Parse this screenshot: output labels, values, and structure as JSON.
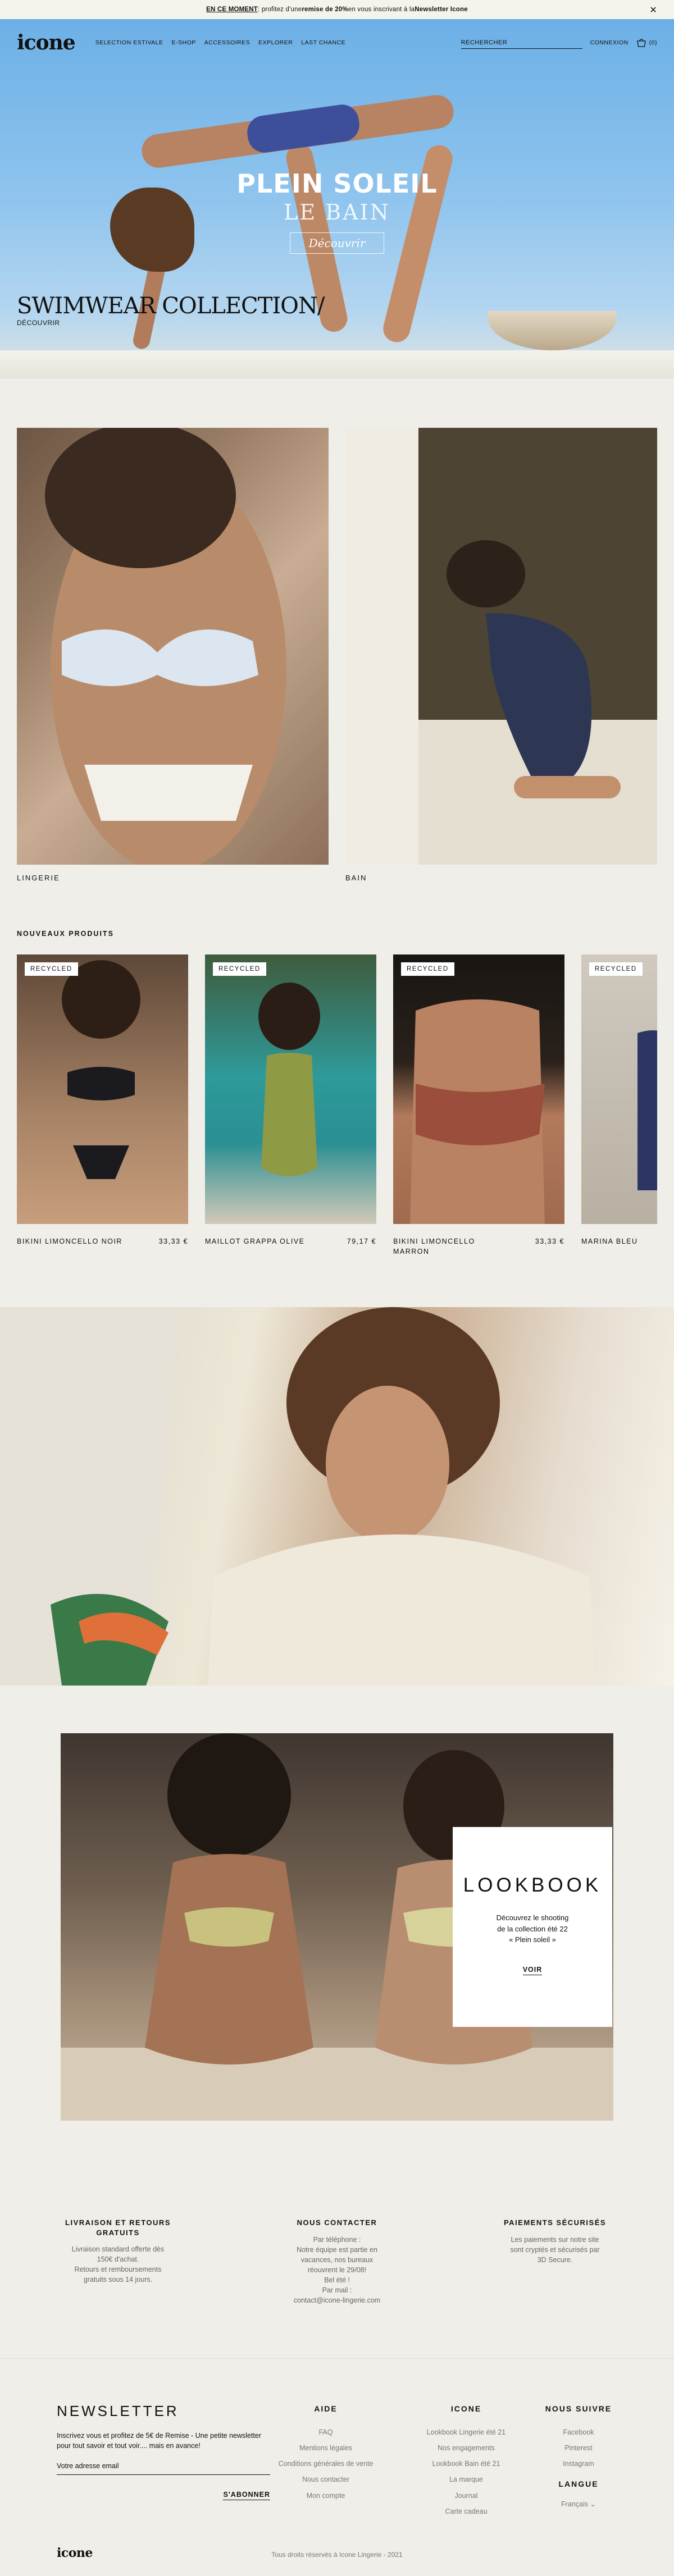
{
  "announcement": {
    "lead": "EN CE MOMENT",
    "text_1": " : profitez d'une ",
    "highlight": "remise de 20%",
    "text_2": " en vous inscrivant à la ",
    "link": "Newsletter Icone",
    "close": "✕"
  },
  "header": {
    "logo": "icone",
    "nav": [
      "SELECTION ESTIVALE",
      "E-SHOP",
      "ACCESSOIRES",
      "EXPLORER",
      "LAST CHANCE"
    ],
    "search_placeholder": "RECHERCHER",
    "account": "CONNEXION",
    "cart_count": "(0)"
  },
  "hero": {
    "title": "PLEIN SOLEIL",
    "subtitle": "LE BAIN",
    "button": "Découvrir",
    "collection": "SWIMWEAR COLLECTION/",
    "discover": "DÉCOUVRIR"
  },
  "categories": [
    {
      "label": "LINGERIE"
    },
    {
      "label": "BAIN"
    }
  ],
  "new_products": {
    "title": "NOUVEAUX PRODUITS",
    "items": [
      {
        "badge": "RECYCLED",
        "name": "BIKINI LIMONCELLO NOIR",
        "price": "33,33 €"
      },
      {
        "badge": "RECYCLED",
        "name": "MAILLOT GRAPPA OLIVE",
        "price": "79,17 €"
      },
      {
        "badge": "RECYCLED",
        "name": "BIKINI LIMONCELLO MARRON",
        "price": "33,33 €"
      },
      {
        "badge": "RECYCLED",
        "name": "MARINA BLEU",
        "price": ""
      }
    ]
  },
  "lookbook": {
    "title": "LOOKBOOK",
    "line_1": "Découvrez le shooting",
    "line_2": "de la collection été 22",
    "line_3": "« Plein soleil »",
    "cta": "VOIR"
  },
  "services": [
    {
      "title": "LIVRAISON ET RETOURS GRATUITS",
      "lines": [
        "Livraison standard offerte dès",
        "150€ d'achat.",
        "Retours et remboursements",
        "gratuits sous 14 jours."
      ]
    },
    {
      "title": "NOUS CONTACTER",
      "lines": [
        "Par téléphone :",
        "Notre équipe est partie en",
        "vacances, nos bureaux",
        "réouvrent le 29/08!",
        "Bel été !",
        "Par mail :",
        "contact@icone-lingerie.com"
      ]
    },
    {
      "title": "PAIEMENTS SÉCURISÉS",
      "lines": [
        "Les paiements sur notre site",
        "sont cryptés et sécurisés par",
        "3D Secure."
      ]
    }
  ],
  "newsletter": {
    "title": "NEWSLETTER",
    "text": "Inscrivez vous et profitez de 5€ de Remise - Une petite newsletter pour tout savoir et tout voir.... mais en avance!",
    "placeholder": "Votre adresse email",
    "button": "S'ABONNER"
  },
  "footer": {
    "aide": {
      "title": "AIDE",
      "items": [
        "FAQ",
        "Mentions légales",
        "Conditions générales de vente",
        "Nous contacter",
        "Mon compte"
      ]
    },
    "icone": {
      "title": "ICONE",
      "items": [
        "Lookbook Lingerie été 21",
        "Nos engagements",
        "Lookbook Bain été 21",
        "La marque",
        "Journal",
        "Carte cadeau"
      ]
    },
    "suivre": {
      "title": "NOUS SUIVRE",
      "items": [
        "Facebook",
        "Pinterest",
        "Instagram"
      ]
    },
    "langue": {
      "title": "LANGUE",
      "selected": "Français"
    },
    "logo": "icone",
    "copyright": "Tous droits réservés à Icone Lingerie - 2021"
  }
}
